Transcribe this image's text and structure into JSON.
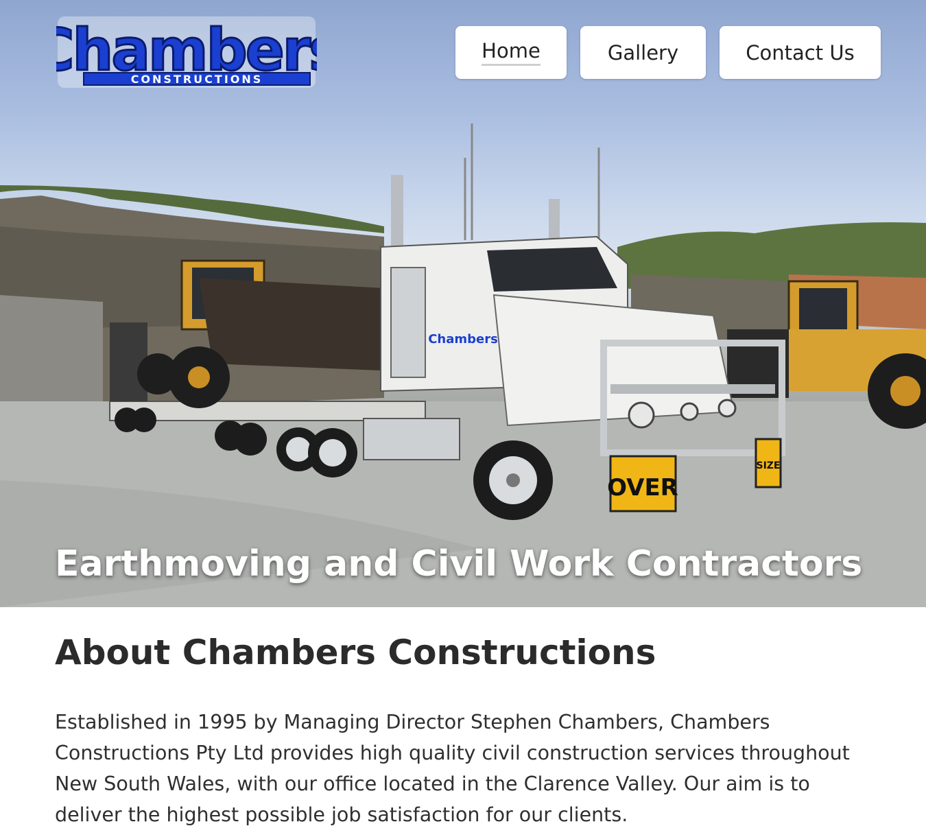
{
  "logo": {
    "main_text": "Chambers",
    "sub_text": "CONSTRUCTIONS",
    "primary_color": "#1a3fd1",
    "outline_color": "#0b1b6b"
  },
  "nav": {
    "items": [
      {
        "label": "Home",
        "active": true
      },
      {
        "label": "Gallery",
        "active": false
      },
      {
        "label": "Contact Us",
        "active": false
      }
    ]
  },
  "hero": {
    "image": "truck-hauling-loader-photo",
    "title": "Earthmoving and Civil Work Contractors",
    "truck_door_text": "Chambers",
    "sign_left": "OVER",
    "sign_right": "SIZE"
  },
  "about": {
    "heading": "About Chambers Constructions",
    "body": "Established in 1995 by Managing Director Stephen Chambers, Chambers Constructions Pty Ltd provides high quality civil construction services throughout New South Wales, with our office located in the Clarence Valley. Our aim is to deliver the highest possible job satisfaction for our clients."
  }
}
